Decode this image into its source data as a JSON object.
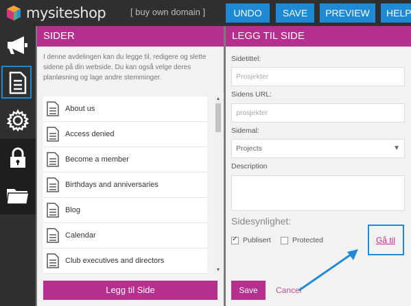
{
  "topbar": {
    "brand": "mysiteshop",
    "domain_link": "[ buy own domain ]",
    "undo": "UNDO",
    "save": "SAVE",
    "preview": "PREVIEW",
    "help": "HELP"
  },
  "sidenav": {
    "items": [
      {
        "icon": "megaphone-icon"
      },
      {
        "icon": "pages-icon",
        "active": true
      },
      {
        "icon": "gear-icon"
      },
      {
        "icon": "lock-icon"
      },
      {
        "icon": "folder-icon"
      }
    ]
  },
  "sider": {
    "title": "SIDER",
    "description": "I denne avdelingen kan du legge til, redigere og slette sidene på din webside. Du kan også velge deres planløsning og lage andre stemminger.",
    "pages": [
      "About us",
      "Access denied",
      "Become a member",
      "Birthdays and anniversaries",
      "Blog",
      "Calendar",
      "Club executives and directors"
    ],
    "add_button": "Legg til Side"
  },
  "legg": {
    "title": "LEGG TIL SIDE",
    "page_title_label": "Sidetittel:",
    "page_title_placeholder": "Prosjekter",
    "url_label": "Sidens URL:",
    "url_placeholder": "prosjekter",
    "template_label": "Sidemal:",
    "template_value": "Projects",
    "description_label": "Description",
    "visibility_title": "Sidesynlighet:",
    "published_label": "Publisert",
    "protected_label": "Protected",
    "goto_link": "Gå til",
    "save_button": "Save",
    "cancel_link": "Cancel"
  },
  "colors": {
    "accent_magenta": "#b52f8e",
    "accent_blue": "#1e8ad6",
    "dark_bg": "#2f2f2f"
  }
}
